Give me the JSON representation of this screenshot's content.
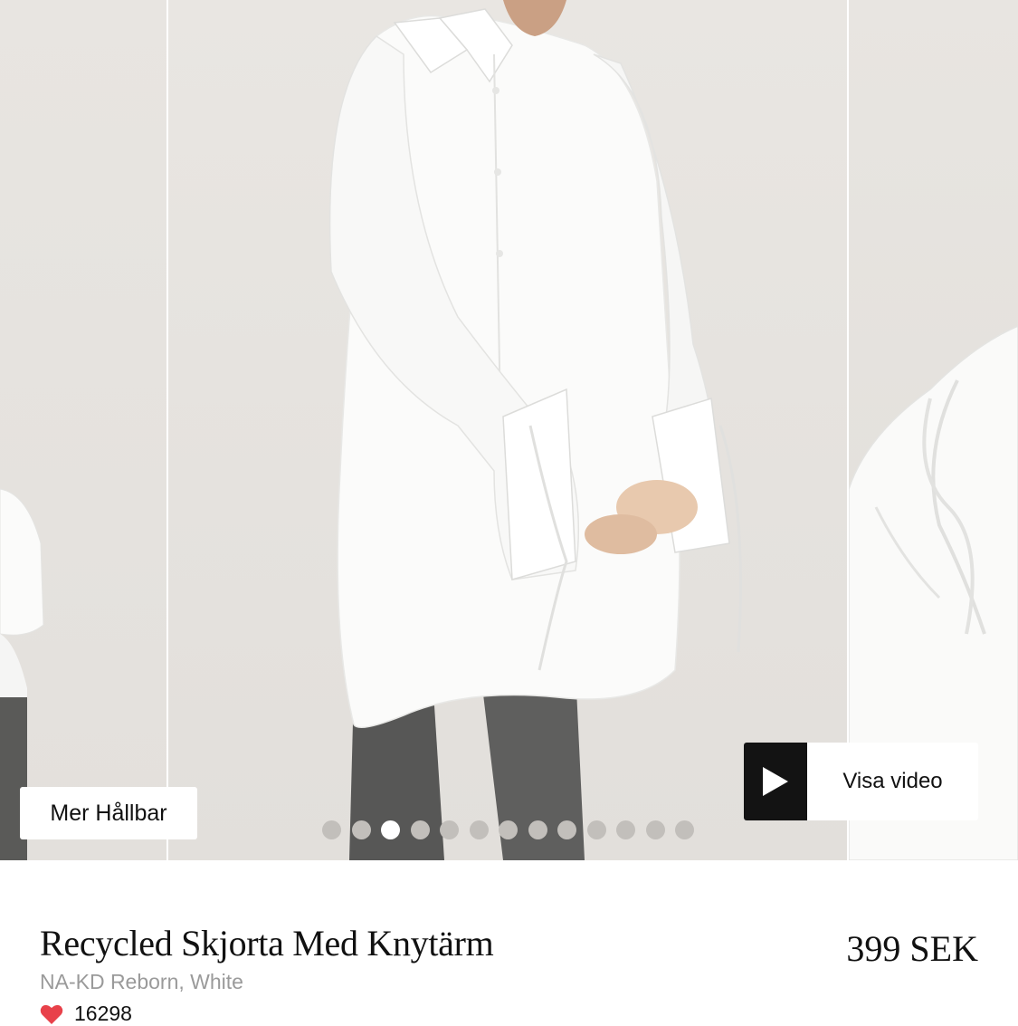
{
  "gallery": {
    "sustainability_badge": "Mer Hållbar",
    "video_button_label": "Visa video",
    "image_count": 13,
    "active_image_index": 2
  },
  "product": {
    "title": "Recycled Skjorta Med Knytärm",
    "brand_color": "NA-KD Reborn, White",
    "price": "399 SEK",
    "likes": "16298"
  },
  "icons": {
    "play": "play-icon",
    "heart": "heart-icon"
  },
  "colors": {
    "heart": "#e8414a",
    "dot_inactive": "#c2bfbb",
    "dot_active": "#ffffff",
    "brand_text": "#9a9a9a"
  }
}
